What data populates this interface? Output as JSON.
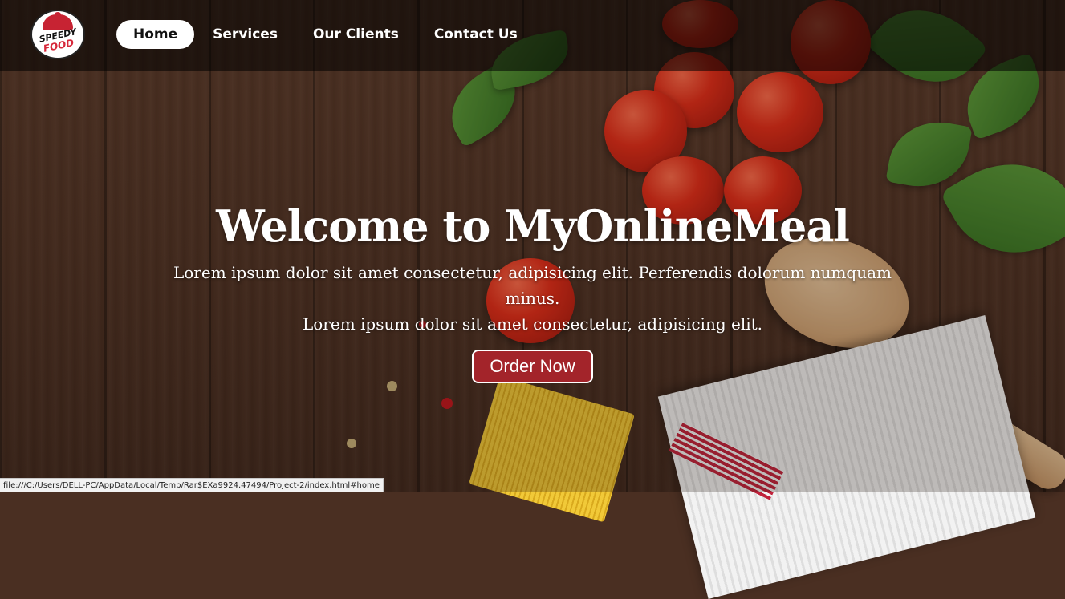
{
  "brand": {
    "logo_line1": "SPEEDY",
    "logo_line2": "FOOD"
  },
  "nav": {
    "items": [
      {
        "label": "Home",
        "active": true
      },
      {
        "label": "Services",
        "active": false
      },
      {
        "label": "Our Clients",
        "active": false
      },
      {
        "label": "Contact Us",
        "active": false
      }
    ]
  },
  "hero": {
    "title": "Welcome to MyOnlineMeal",
    "line1": "Lorem ipsum dolor sit amet consectetur, adipisicing elit. Perferendis dolorum numquam minus.",
    "line2": "Lorem ipsum dolor sit amet consectetur, adipisicing elit.",
    "button_label": "Order Now"
  },
  "status_bar": {
    "url": "file:///C:/Users/DELL-PC/AppData/Local/Temp/Rar$EXa9924.47494/Project-2/index.html#home"
  },
  "colors": {
    "button": "#a3242a",
    "logo_red": "#c72333"
  }
}
